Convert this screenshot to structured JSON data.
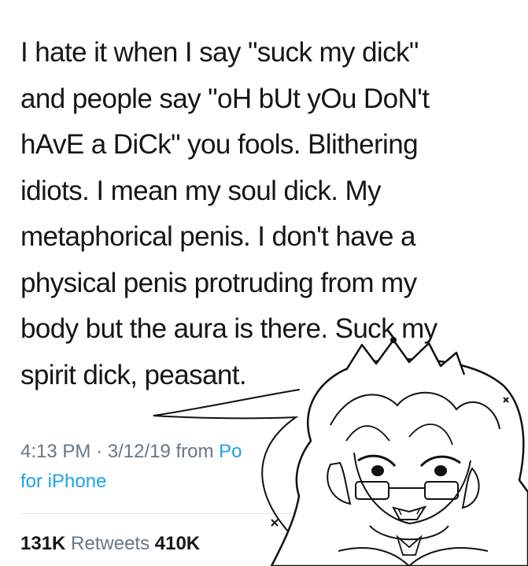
{
  "tweet": {
    "lines": [
      "I hate it when I say \"suck my dick\"",
      "and people say \"oH bUt yOu DoN't",
      "hAvE a DiCk\" you fools. Blithering",
      "idiots. I mean my soul dick. My",
      "metaphorical penis. I don't have a",
      "physical penis protruding from my",
      "body but the aura is there. Suck my",
      "spirit dick, peasant."
    ]
  },
  "meta": {
    "time": "4:13 PM",
    "separator": "·",
    "date": "3/12/19",
    "from": "from",
    "source_partial": "Po",
    "source_line2": "for iPhone"
  },
  "stats": {
    "retweets_count": "131K",
    "retweets_label": "Retweets",
    "likes_count_partial": "410K"
  },
  "colors": {
    "text": "#14171a",
    "secondary": "#657786",
    "link": "#1da1f2",
    "divider": "#e1e8ed"
  }
}
